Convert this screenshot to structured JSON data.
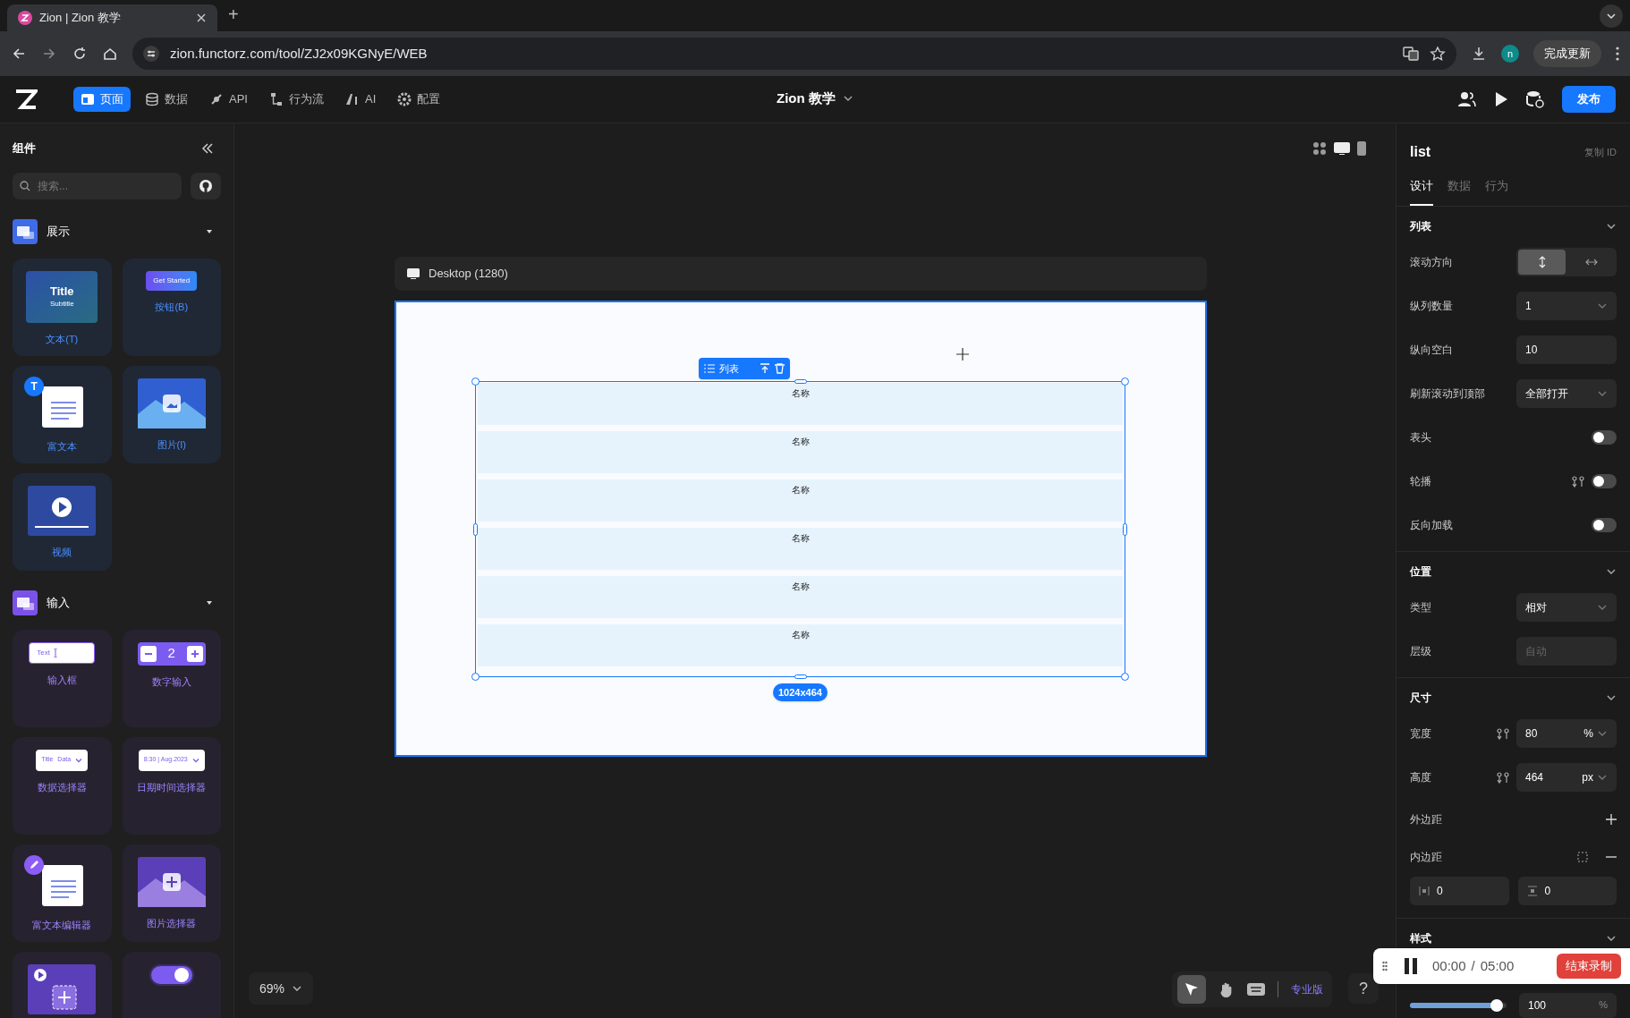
{
  "browser": {
    "tab_title": "Zion | Zion 教学",
    "new_tab": "+",
    "address": "zion.functorz.com/tool/ZJ2x09KGNyE/WEB",
    "profile": "n",
    "update_button": "完成更新"
  },
  "app_bar": {
    "nav": [
      {
        "label": "页面",
        "selected": true
      },
      {
        "label": "数据",
        "selected": false
      },
      {
        "label": "API",
        "selected": false
      },
      {
        "label": "行为流",
        "selected": false
      },
      {
        "label": "AI",
        "selected": false
      },
      {
        "label": "配置",
        "selected": false
      }
    ],
    "project_title": "Zion 教学",
    "publish": "发布"
  },
  "components_panel": {
    "title": "组件",
    "search": {
      "placeholder": "搜索..."
    },
    "sections": [
      {
        "title": "展示",
        "items": [
          {
            "label": "文本(T)",
            "kind": "text",
            "preview_texts": [
              "Title",
              "Subtitle"
            ]
          },
          {
            "label": "按钮(B)",
            "kind": "button",
            "preview_texts": [
              "Get Started"
            ]
          },
          {
            "label": "富文本",
            "kind": "richtext",
            "preview_texts": [
              "T"
            ]
          },
          {
            "label": "图片(I)",
            "kind": "image"
          },
          {
            "label": "视频",
            "kind": "video"
          }
        ]
      },
      {
        "title": "输入",
        "items": [
          {
            "label": "输入框",
            "kind": "input",
            "preview_texts": [
              "Text"
            ]
          },
          {
            "label": "数字输入",
            "kind": "number",
            "preview_texts": [
              "2"
            ]
          },
          {
            "label": "数据选择器",
            "kind": "select",
            "preview_texts": [
              "Title",
              "Data"
            ]
          },
          {
            "label": "日期时间选择器",
            "kind": "datetime",
            "preview_texts": [
              "8:30 | Aug.2023"
            ]
          },
          {
            "label": "富文本编辑器",
            "kind": "editor"
          },
          {
            "label": "图片选择器",
            "kind": "imagepicker"
          },
          {
            "kind": "videopicker"
          },
          {
            "kind": "switch"
          }
        ]
      }
    ]
  },
  "canvas": {
    "device_label": "Desktop (1280)",
    "list_toolbar": {
      "label": "列表"
    },
    "list_rows": [
      "名称",
      "名称",
      "名称",
      "名称",
      "名称",
      "名称"
    ],
    "size_badge": "1024x464",
    "zoom": "69%",
    "plan_label": "专业版",
    "help": "?"
  },
  "properties_panel": {
    "title": "list",
    "copy_id": "复制 ID",
    "tabs": [
      {
        "label": "设计",
        "selected": true
      },
      {
        "label": "数据",
        "selected": false
      },
      {
        "label": "行为",
        "selected": false
      }
    ],
    "sections": [
      {
        "title": "列表",
        "rows": [
          {
            "label": "滚动方向",
            "kind": "segment",
            "options": [
              {
                "selected": true
              },
              {
                "selected": false
              }
            ]
          },
          {
            "label": "纵列数量",
            "kind": "select",
            "value": "1"
          },
          {
            "label": "纵向空白",
            "kind": "input",
            "value": "10"
          },
          {
            "label": "刷新滚动到顶部",
            "kind": "select",
            "value": "全部打开"
          },
          {
            "label": "表头",
            "kind": "toggle",
            "on": false
          },
          {
            "label": "轮播",
            "kind": "toggle",
            "on": false,
            "binding": true
          },
          {
            "label": "反向加载",
            "kind": "toggle",
            "on": false
          }
        ]
      },
      {
        "title": "位置",
        "rows": [
          {
            "label": "类型",
            "kind": "select",
            "value": "相对"
          },
          {
            "label": "层级",
            "kind": "input",
            "placeholder": "自动"
          }
        ]
      },
      {
        "title": "尺寸",
        "rows": [
          {
            "label": "宽度",
            "kind": "unit",
            "value": "80",
            "unit": "%",
            "binding": true
          },
          {
            "label": "高度",
            "kind": "unit",
            "value": "464",
            "unit": "px",
            "binding": true
          },
          {
            "label": "外边距",
            "kind": "add"
          },
          {
            "label": "内边距",
            "kind": "remove"
          },
          {
            "kind": "pair",
            "values": [
              "0",
              "0"
            ]
          }
        ]
      },
      {
        "title": "样式"
      }
    ],
    "opacity": {
      "level": 0.9,
      "value": "100",
      "unit": "%"
    }
  },
  "recorder": {
    "elapsed": "00:00",
    "separator": "/",
    "total": "05:00",
    "stop": "结束录制"
  }
}
